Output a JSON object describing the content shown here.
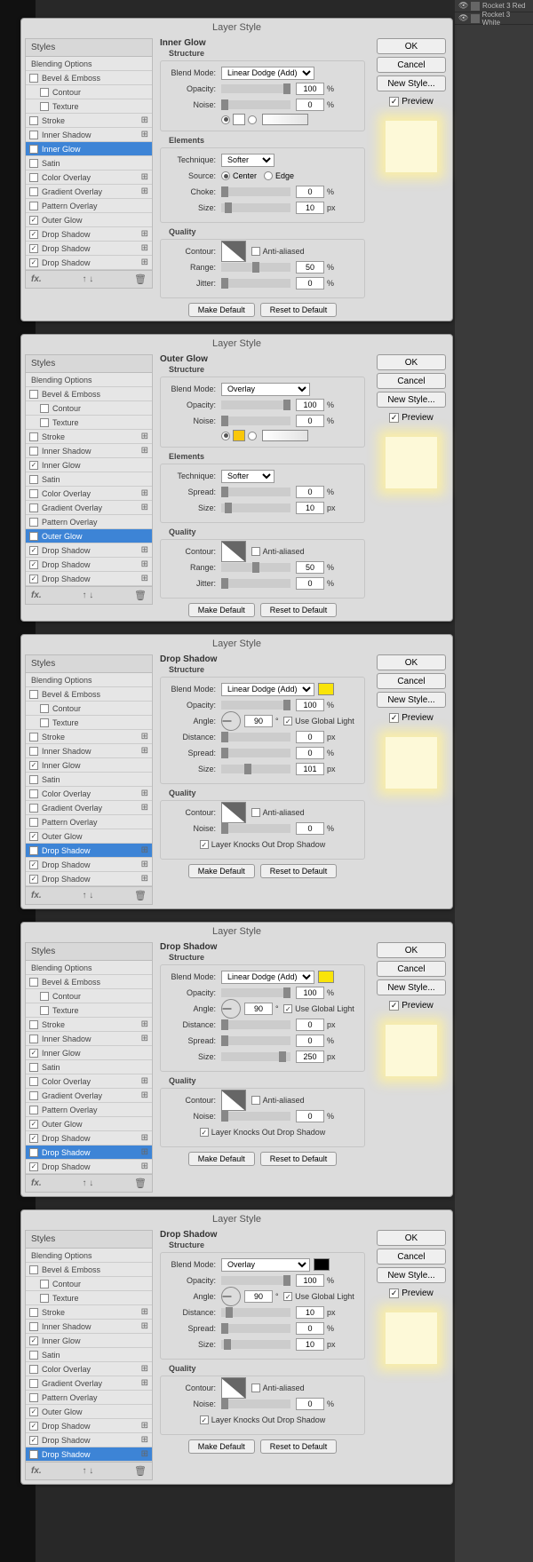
{
  "dialogTitle": "Layer Style",
  "stylesHeader": "Styles",
  "layers": {
    "rocket3red": "Rocket 3 Red",
    "rocket3white": "Rocket 3 White"
  },
  "styleItems": {
    "blending": "Blending Options",
    "bevel": "Bevel & Emboss",
    "contour": "Contour",
    "texture": "Texture",
    "stroke": "Stroke",
    "innerShadow": "Inner Shadow",
    "innerGlow": "Inner Glow",
    "satin": "Satin",
    "colorOverlay": "Color Overlay",
    "gradientOverlay": "Gradient Overlay",
    "patternOverlay": "Pattern Overlay",
    "outerGlow": "Outer Glow",
    "dropShadow": "Drop Shadow"
  },
  "buttons": {
    "ok": "OK",
    "cancel": "Cancel",
    "newStyle": "New Style...",
    "preview": "Preview",
    "makeDefault": "Make Default",
    "resetDefault": "Reset to Default"
  },
  "labels": {
    "blendMode": "Blend Mode:",
    "opacity": "Opacity:",
    "noise": "Noise:",
    "technique": "Technique:",
    "source": "Source:",
    "center": "Center",
    "edge": "Edge",
    "choke": "Choke:",
    "size": "Size:",
    "spread": "Spread:",
    "angle": "Angle:",
    "distance": "Distance:",
    "contour": "Contour:",
    "antialiased": "Anti-aliased",
    "range": "Range:",
    "jitter": "Jitter:",
    "useGlobal": "Use Global Light",
    "knocksOut": "Layer Knocks Out Drop Shadow"
  },
  "sections": {
    "structure": "Structure",
    "elements": "Elements",
    "quality": "Quality"
  },
  "panels": [
    {
      "title": "Inner Glow",
      "selected": "innerGlow",
      "settings": {
        "blendMode": "Linear Dodge (Add)",
        "opacity": 100,
        "noise": 0,
        "swatch1": "#ffffff",
        "technique": "Softer",
        "sourceCenter": true,
        "choke": 0,
        "size": 10,
        "range": 50,
        "jitter": 0
      }
    },
    {
      "title": "Outer Glow",
      "selected": "outerGlow",
      "settings": {
        "blendMode": "Overlay",
        "opacity": 100,
        "noise": 0,
        "swatch1": "#f9c709",
        "gradient": true,
        "technique": "Softer",
        "spread": 0,
        "size": 10,
        "range": 50,
        "jitter": 0
      }
    },
    {
      "title": "Drop Shadow",
      "selected": "dropShadow1",
      "settings": {
        "blendMode": "Linear Dodge (Add)",
        "color": "#f9e409",
        "opacity": 100,
        "angle": 90,
        "useGlobal": true,
        "distance": 0,
        "spread": 0,
        "size": 101,
        "noise": 0,
        "knocksOut": true
      }
    },
    {
      "title": "Drop Shadow",
      "selected": "dropShadow2",
      "settings": {
        "blendMode": "Linear Dodge (Add)",
        "color": "#f9e409",
        "opacity": 100,
        "angle": 90,
        "useGlobal": true,
        "distance": 0,
        "spread": 0,
        "size": 250,
        "noise": 0,
        "knocksOut": true
      }
    },
    {
      "title": "Drop Shadow",
      "selected": "dropShadow3",
      "settings": {
        "blendMode": "Overlay",
        "color": "#000000",
        "opacity": 100,
        "angle": 90,
        "useGlobal": true,
        "distance": 10,
        "spread": 0,
        "size": 10,
        "noise": 0,
        "knocksOut": true
      }
    }
  ]
}
